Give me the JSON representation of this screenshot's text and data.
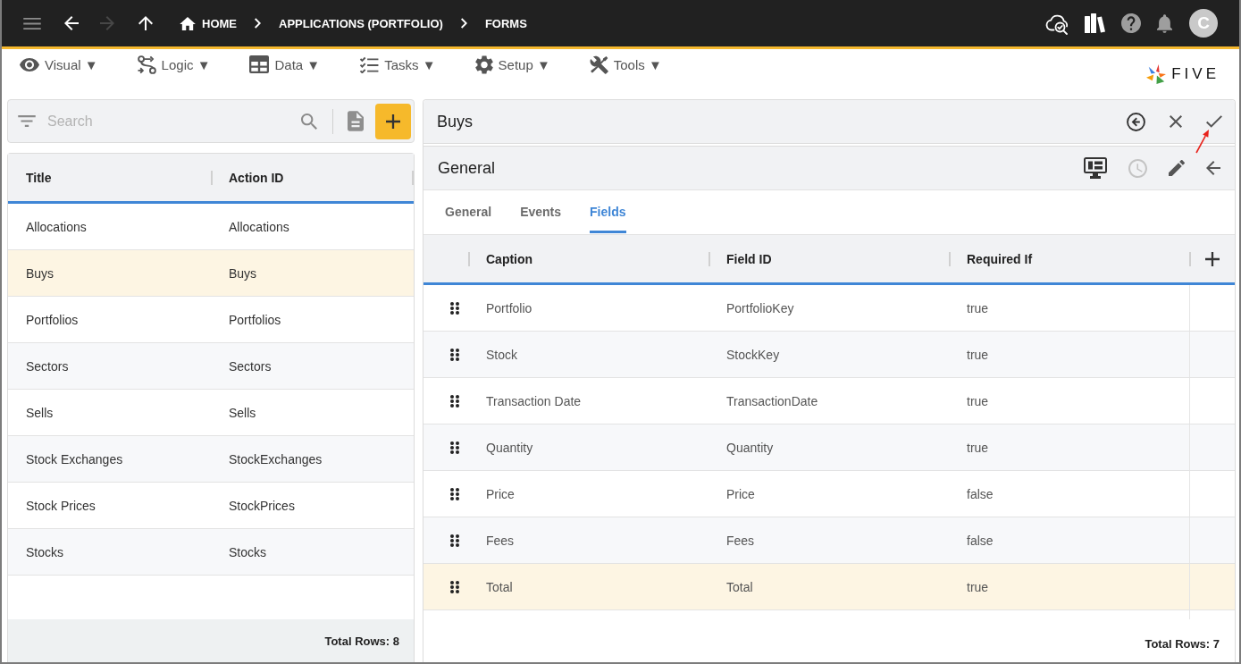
{
  "top_bar": {
    "nav_buttons": [
      {
        "kind": "menu",
        "disabled": false
      },
      {
        "kind": "back",
        "disabled": false
      },
      {
        "kind": "forward",
        "disabled": true
      },
      {
        "kind": "up",
        "disabled": false
      }
    ],
    "breadcrumbs": [
      {
        "kind": "home",
        "label": "HOME"
      },
      {
        "kind": "link",
        "label": "APPLICATIONS (PORTFOLIO)"
      },
      {
        "kind": "link",
        "label": "FORMS"
      }
    ],
    "actions": [
      {
        "kind": "cloud-search"
      },
      {
        "kind": "books"
      },
      {
        "kind": "help"
      },
      {
        "kind": "notifications"
      }
    ],
    "avatar": {
      "initial": "C"
    }
  },
  "menu_bar": {
    "items": [
      {
        "kind": "visual",
        "label": "Visual ▼"
      },
      {
        "kind": "logic",
        "label": "Logic ▼"
      },
      {
        "kind": "data",
        "label": "Data ▼"
      },
      {
        "kind": "tasks",
        "label": "Tasks ▼"
      },
      {
        "kind": "setup",
        "label": "Setup ▼"
      },
      {
        "kind": "tools",
        "label": "Tools ▼"
      }
    ],
    "logo": {
      "text": "FIVE"
    }
  },
  "list_panel": {
    "search": {
      "placeholder": "Search"
    },
    "list": {
      "columns": [
        "Title",
        "Action ID"
      ],
      "rows": [
        {
          "cells": [
            "Allocations",
            "Allocations"
          ],
          "selected": false
        },
        {
          "cells": [
            "Buys",
            "Buys"
          ],
          "selected": true
        },
        {
          "cells": [
            "Portfolios",
            "Portfolios"
          ],
          "selected": false
        },
        {
          "cells": [
            "Sectors",
            "Sectors"
          ],
          "selected": false
        },
        {
          "cells": [
            "Sells",
            "Sells"
          ],
          "selected": false
        },
        {
          "cells": [
            "Stock Exchanges",
            "StockExchanges"
          ],
          "selected": false
        },
        {
          "cells": [
            "Stock Prices",
            "StockPrices"
          ],
          "selected": false
        },
        {
          "cells": [
            "Stocks",
            "Stocks"
          ],
          "selected": false
        }
      ],
      "total": "Total Rows: 8"
    }
  },
  "form_panel": {
    "title": "Buys",
    "actions": [
      {
        "kind": "back-circle"
      },
      {
        "kind": "close"
      },
      {
        "kind": "confirm"
      }
    ],
    "section": {
      "title": "General",
      "actions": [
        {
          "kind": "monitor",
          "disabled": false
        },
        {
          "kind": "history",
          "disabled": true
        },
        {
          "kind": "edit",
          "disabled": false
        },
        {
          "kind": "back",
          "disabled": false
        }
      ],
      "tabs": [
        {
          "label": "General",
          "selected": false
        },
        {
          "label": "Events",
          "selected": false
        },
        {
          "label": "Fields",
          "selected": true
        }
      ],
      "table": {
        "columns": [
          "Caption",
          "Field ID",
          "Required If"
        ],
        "rows": [
          {
            "cells": [
              "Portfolio",
              "PortfolioKey",
              "true"
            ],
            "selected": false
          },
          {
            "cells": [
              "Stock",
              "StockKey",
              "true"
            ],
            "selected": false
          },
          {
            "cells": [
              "Transaction Date",
              "TransactionDate",
              "true"
            ],
            "selected": false
          },
          {
            "cells": [
              "Quantity",
              "Quantity",
              "true"
            ],
            "selected": false
          },
          {
            "cells": [
              "Price",
              "Price",
              "false"
            ],
            "selected": false
          },
          {
            "cells": [
              "Fees",
              "Fees",
              "false"
            ],
            "selected": false
          },
          {
            "cells": [
              "Total",
              "Total",
              "true"
            ],
            "selected": true
          }
        ],
        "total": "Total Rows: 7"
      }
    }
  }
}
